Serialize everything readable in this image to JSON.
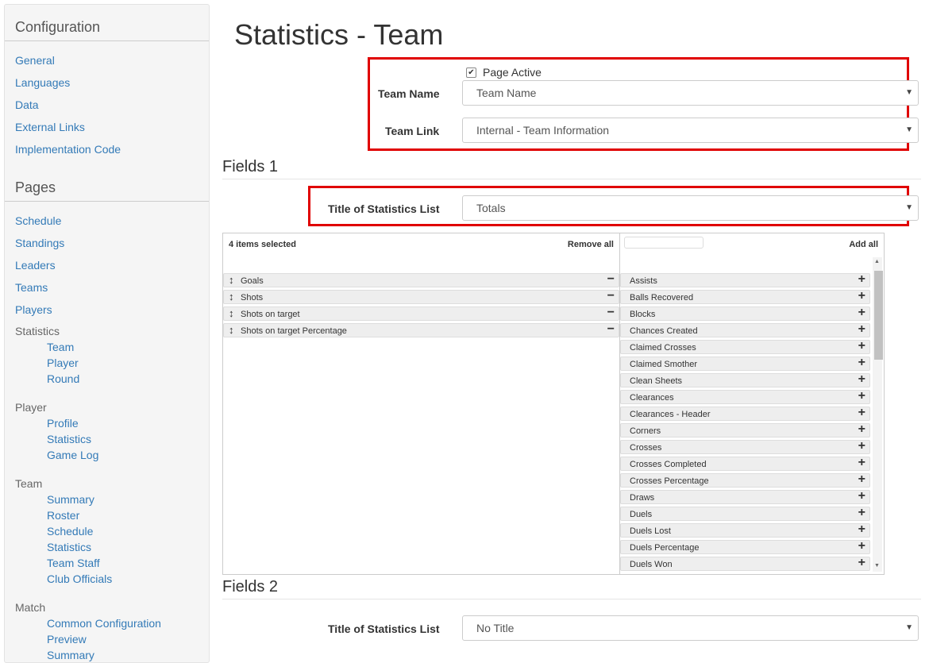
{
  "sidebar": {
    "configuration_header": "Configuration",
    "configuration_links": [
      "General",
      "Languages",
      "Data",
      "External Links",
      "Implementation Code"
    ],
    "pages_header": "Pages",
    "pages_links": [
      "Schedule",
      "Standings",
      "Leaders",
      "Teams",
      "Players"
    ],
    "groups": [
      {
        "label": "Statistics",
        "items": [
          "Team",
          "Player",
          "Round"
        ]
      },
      {
        "label": "Player",
        "items": [
          "Profile",
          "Statistics",
          "Game Log"
        ]
      },
      {
        "label": "Team",
        "items": [
          "Summary",
          "Roster",
          "Schedule",
          "Statistics",
          "Team Staff",
          "Club Officials"
        ]
      },
      {
        "label": "Match",
        "items": [
          "Common Configuration",
          "Preview",
          "Summary"
        ]
      }
    ]
  },
  "page": {
    "title": "Statistics - Team",
    "page_active_label": "Page Active",
    "page_active_checked": "✔",
    "team_name_label": "Team Name",
    "team_name_value": "Team Name",
    "team_link_label": "Team Link",
    "team_link_value": "Internal - Team Information",
    "fields1_title": "Fields 1",
    "fields1_list_label": "Title of Statistics List",
    "fields1_list_value": "Totals",
    "fields2_title": "Fields 2",
    "fields2_list_label": "Title of Statistics List",
    "fields2_list_value": "No Title"
  },
  "multiselect": {
    "selected_count": "4 items selected",
    "remove_all": "Remove all",
    "add_all": "Add all",
    "selected_items": [
      "Goals",
      "Shots",
      "Shots on target",
      "Shots on target Percentage"
    ],
    "available_items": [
      "Assists",
      "Balls Recovered",
      "Blocks",
      "Chances Created",
      "Claimed Crosses",
      "Claimed Smother",
      "Clean Sheets",
      "Clearances",
      "Clearances - Header",
      "Corners",
      "Crosses",
      "Crosses Completed",
      "Crosses Percentage",
      "Draws",
      "Duels",
      "Duels Lost",
      "Duels Percentage",
      "Duels Won"
    ]
  },
  "colors": {
    "highlight_border": "#e00000",
    "link": "#337ab7"
  }
}
